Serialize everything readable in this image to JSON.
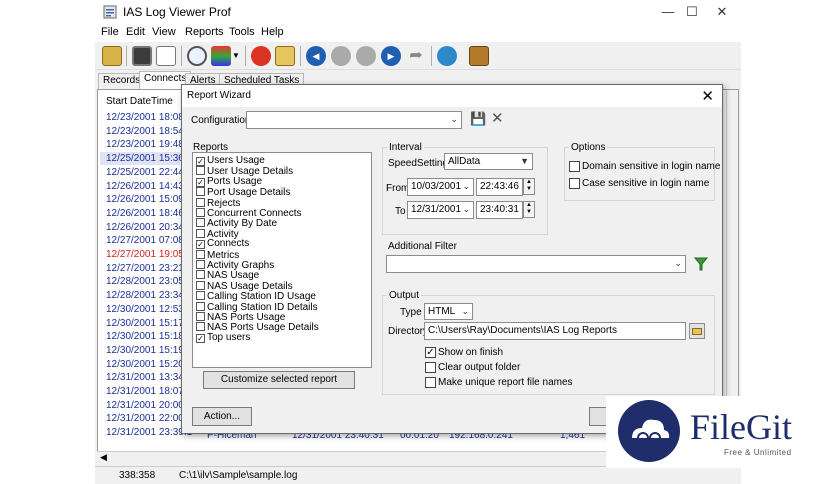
{
  "window": {
    "title": "IAS Log Viewer Prof"
  },
  "menu": [
    "File",
    "Edit",
    "View",
    "Reports",
    "Tools",
    "Help"
  ],
  "tabs": [
    "Records",
    "Connects",
    "Alerts",
    "Scheduled Tasks"
  ],
  "list": {
    "header": "Start DateTime",
    "rows": [
      "12/23/2001 18:08:4",
      "12/23/2001 18:54:5",
      "12/23/2001 19:48:4",
      "12/25/2001 15:36:3",
      "12/25/2001 22:44:4",
      "12/26/2001 14:43:4",
      "12/26/2001 15:09:1",
      "12/26/2001 18:46:3",
      "12/26/2001 20:34:4",
      "12/27/2001 07:08:3",
      "12/27/2001 19:05:2",
      "12/27/2001 23:21:1",
      "12/28/2001 23:05:3",
      "12/28/2001 23:34:5",
      "12/30/2001 12:53:4",
      "12/30/2001 15:17:0",
      "12/30/2001 15:18:1",
      "12/30/2001 15:19:2",
      "12/30/2001 15:20:2",
      "12/31/2001 13:34:1",
      "12/31/2001 18:07:1",
      "12/31/2001 20:00:2",
      "12/31/2001 22:00:3",
      "12/31/2001 23:39:1"
    ],
    "last_row_extra": [
      "P-Hiceman",
      "12/31/2001 23:40:31",
      "00:01:20",
      "192.168.0.241",
      "1,461"
    ]
  },
  "status": {
    "position": "338:358",
    "file": "C:\\1\\ilv\\Sample\\sample.log"
  },
  "dialog": {
    "title": "Report Wizard",
    "configuration_label": "Configuration",
    "configuration_value": "",
    "reports_label": "Reports",
    "reports": [
      {
        "label": "Users Usage",
        "checked": true
      },
      {
        "label": "User Usage Details",
        "checked": false
      },
      {
        "label": "Ports Usage",
        "checked": true
      },
      {
        "label": "Port Usage Details",
        "checked": false
      },
      {
        "label": "Rejects",
        "checked": false
      },
      {
        "label": "Concurrent Connects",
        "checked": false
      },
      {
        "label": "Activity By Date",
        "checked": false
      },
      {
        "label": "Activity",
        "checked": false
      },
      {
        "label": "Connects",
        "checked": true
      },
      {
        "label": "Metrics",
        "checked": false
      },
      {
        "label": "Activity Graphs",
        "checked": false
      },
      {
        "label": "NAS Usage",
        "checked": false
      },
      {
        "label": "NAS Usage Details",
        "checked": false
      },
      {
        "label": "Calling Station ID Usage",
        "checked": false
      },
      {
        "label": "Calling Station ID Details",
        "checked": false
      },
      {
        "label": "NAS Ports Usage",
        "checked": false
      },
      {
        "label": "NAS Ports Usage Details",
        "checked": false
      },
      {
        "label": "Top users",
        "checked": true
      }
    ],
    "customize_button": "Customize selected report",
    "action_button": "Action...",
    "interval": {
      "label": "Interval",
      "speed_label": "SpeedSetting",
      "speed_value": "AllData",
      "from_label": "From",
      "from_date": "10/03/2001",
      "from_time": "22:43:46",
      "to_label": "To",
      "to_date": "12/31/2001",
      "to_time": "23:40:31"
    },
    "options": {
      "label": "Options",
      "domain_sensitive": "Domain sensitive in login name",
      "case_sensitive": "Case sensitive in login name"
    },
    "additional_filter_label": "Additional Filter",
    "additional_filter_value": "",
    "output": {
      "label": "Output",
      "type_label": "Type",
      "type_value": "HTML",
      "directory_label": "Directory",
      "directory_value": "C:\\Users\\Ray\\Documents\\IAS Log Reports",
      "show_on_finish": "Show on finish",
      "clear_output": "Clear output folder",
      "make_unique": "Make unique report file names"
    }
  },
  "watermark": {
    "name": "FileGit",
    "tagline": "Free & Unlimited"
  },
  "colors": {
    "link_blue": "#1a2f9a",
    "alert_red": "#d42020",
    "brand_navy": "#1f2d6b"
  }
}
